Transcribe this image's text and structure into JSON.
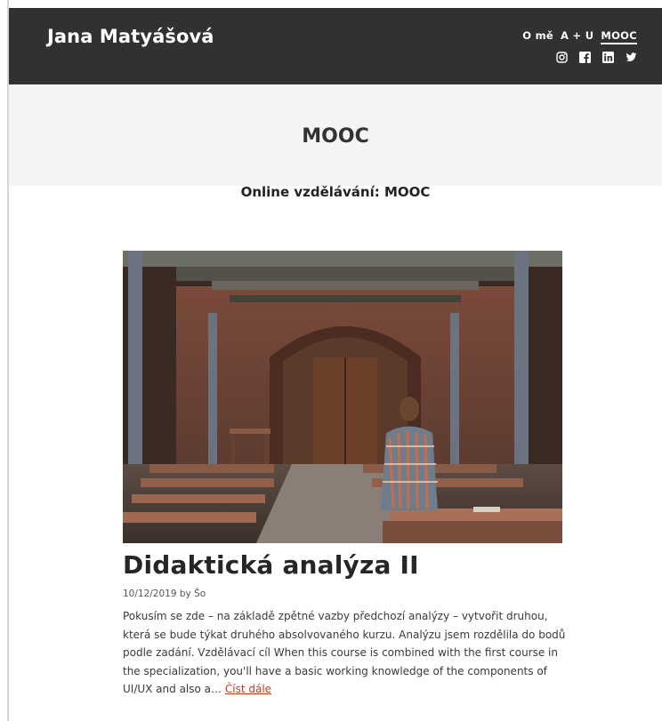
{
  "site": {
    "title": "Jana Matyášová"
  },
  "nav": {
    "items": [
      {
        "label": "O mě"
      },
      {
        "label": "A + U"
      },
      {
        "label": "MOOC"
      }
    ]
  },
  "socials": [
    "instagram-icon",
    "facebook-icon",
    "linkedin-icon",
    "twitter-icon"
  ],
  "hero": {
    "title": "MOOC"
  },
  "category": {
    "title": "Online vzdělávání: MOOC"
  },
  "post": {
    "title": "Didaktická analýza II",
    "date": "10/12/2019",
    "by": "by",
    "author": "Šo",
    "excerpt": "Pokusím se zde – na základě zpětné vazby předchozí analýzy – vytvořit druhou, která se bude týkat druhého absolvovaného kurzu. Analýzu jsem rozdělila do bodů podle zadání. Vzdělávací cíl When this course is combined with the first course in the specialization, you'll have a basic working knowledge of the components of UI/UX and also a…",
    "read_more": "Číst dále"
  },
  "colors": {
    "header_bg": "#313131",
    "hero_bg": "#f4f4f4",
    "link": "#c0392b"
  }
}
